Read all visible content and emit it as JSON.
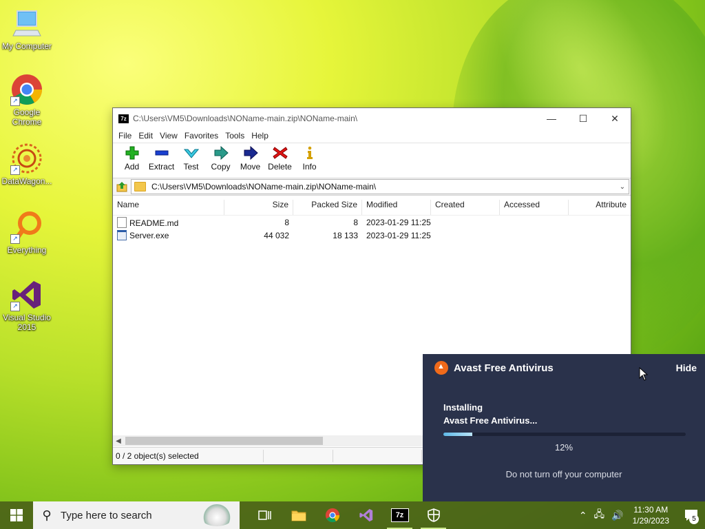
{
  "desktop": {
    "icons": [
      {
        "label": "My Computer"
      },
      {
        "label": "Google Chrome"
      },
      {
        "label": "DataWagon..."
      },
      {
        "label": "Everything"
      },
      {
        "label": "Visual Studio 2015"
      }
    ]
  },
  "window": {
    "title": "C:\\Users\\VM5\\Downloads\\NOName-main.zip\\NOName-main\\",
    "menu": [
      "File",
      "Edit",
      "View",
      "Favorites",
      "Tools",
      "Help"
    ],
    "toolbar": [
      "Add",
      "Extract",
      "Test",
      "Copy",
      "Move",
      "Delete",
      "Info"
    ],
    "address": "C:\\Users\\VM5\\Downloads\\NOName-main.zip\\NOName-main\\",
    "columns": [
      "Name",
      "Size",
      "Packed Size",
      "Modified",
      "Created",
      "Accessed",
      "Attribute"
    ],
    "files": [
      {
        "name": "README.md",
        "size": "8",
        "packed": "8",
        "modified": "2023-01-29 11:25",
        "created": "",
        "accessed": "",
        "attr": ""
      },
      {
        "name": "Server.exe",
        "size": "44 032",
        "packed": "18 133",
        "modified": "2023-01-29 11:25",
        "created": "",
        "accessed": "",
        "attr": ""
      }
    ],
    "status": "0 / 2 object(s) selected"
  },
  "avast": {
    "title": "Avast Free Antivirus",
    "hide": "Hide",
    "line1": "Installing",
    "line2": "Avast Free Antivirus...",
    "progress": 0.12,
    "percent": "12%",
    "warning": "Do not turn off your computer"
  },
  "taskbar": {
    "search_placeholder": "Type here to search",
    "time": "11:30 AM",
    "date": "1/29/2023",
    "notifications": "5"
  }
}
